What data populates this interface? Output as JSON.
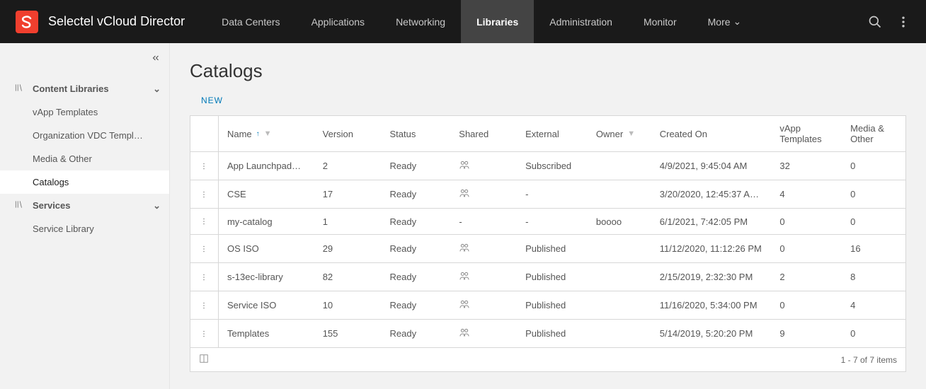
{
  "app_title": "Selectel vCloud Director",
  "nav": [
    {
      "label": "Data Centers",
      "active": false
    },
    {
      "label": "Applications",
      "active": false
    },
    {
      "label": "Networking",
      "active": false
    },
    {
      "label": "Libraries",
      "active": true
    },
    {
      "label": "Administration",
      "active": false
    },
    {
      "label": "Monitor",
      "active": false
    },
    {
      "label": "More",
      "active": false,
      "chevron": true
    }
  ],
  "sidebar": {
    "groups": [
      {
        "label": "Content Libraries",
        "items": [
          {
            "label": "vApp Templates",
            "active": false
          },
          {
            "label": "Organization VDC Templ…",
            "active": false
          },
          {
            "label": "Media & Other",
            "active": false
          },
          {
            "label": "Catalogs",
            "active": true
          }
        ]
      },
      {
        "label": "Services",
        "items": [
          {
            "label": "Service Library",
            "active": false
          }
        ]
      }
    ]
  },
  "page": {
    "heading": "Catalogs",
    "new_label": "NEW"
  },
  "columns": {
    "name": "Name",
    "version": "Version",
    "status": "Status",
    "shared": "Shared",
    "external": "External",
    "owner": "Owner",
    "created": "Created On",
    "vapp": "vApp Templates",
    "media": "Media & Other"
  },
  "rows": [
    {
      "name": "App Launchpad…",
      "version": "2",
      "status": "Ready",
      "shared": true,
      "external": "Subscribed",
      "owner": "",
      "created": "4/9/2021, 9:45:04 AM",
      "vapp": "32",
      "media": "0"
    },
    {
      "name": "CSE",
      "version": "17",
      "status": "Ready",
      "shared": true,
      "external": "-",
      "owner": "",
      "created": "3/20/2020, 12:45:37 A…",
      "vapp": "4",
      "media": "0"
    },
    {
      "name": "my-catalog",
      "version": "1",
      "status": "Ready",
      "shared": false,
      "external": "-",
      "owner": "boooo",
      "created": "6/1/2021, 7:42:05 PM",
      "vapp": "0",
      "media": "0"
    },
    {
      "name": "OS ISO",
      "version": "29",
      "status": "Ready",
      "shared": true,
      "external": "Published",
      "owner": "",
      "created": "11/12/2020, 11:12:26 PM",
      "vapp": "0",
      "media": "16"
    },
    {
      "name": "s-13ec-library",
      "version": "82",
      "status": "Ready",
      "shared": true,
      "external": "Published",
      "owner": "",
      "created": "2/15/2019, 2:32:30 PM",
      "vapp": "2",
      "media": "8"
    },
    {
      "name": "Service ISO",
      "version": "10",
      "status": "Ready",
      "shared": true,
      "external": "Published",
      "owner": "",
      "created": "11/16/2020, 5:34:00 PM",
      "vapp": "0",
      "media": "4"
    },
    {
      "name": "Templates",
      "version": "155",
      "status": "Ready",
      "shared": true,
      "external": "Published",
      "owner": "",
      "created": "5/14/2019, 5:20:20 PM",
      "vapp": "9",
      "media": "0"
    }
  ],
  "pagination": "1 - 7 of 7 items"
}
